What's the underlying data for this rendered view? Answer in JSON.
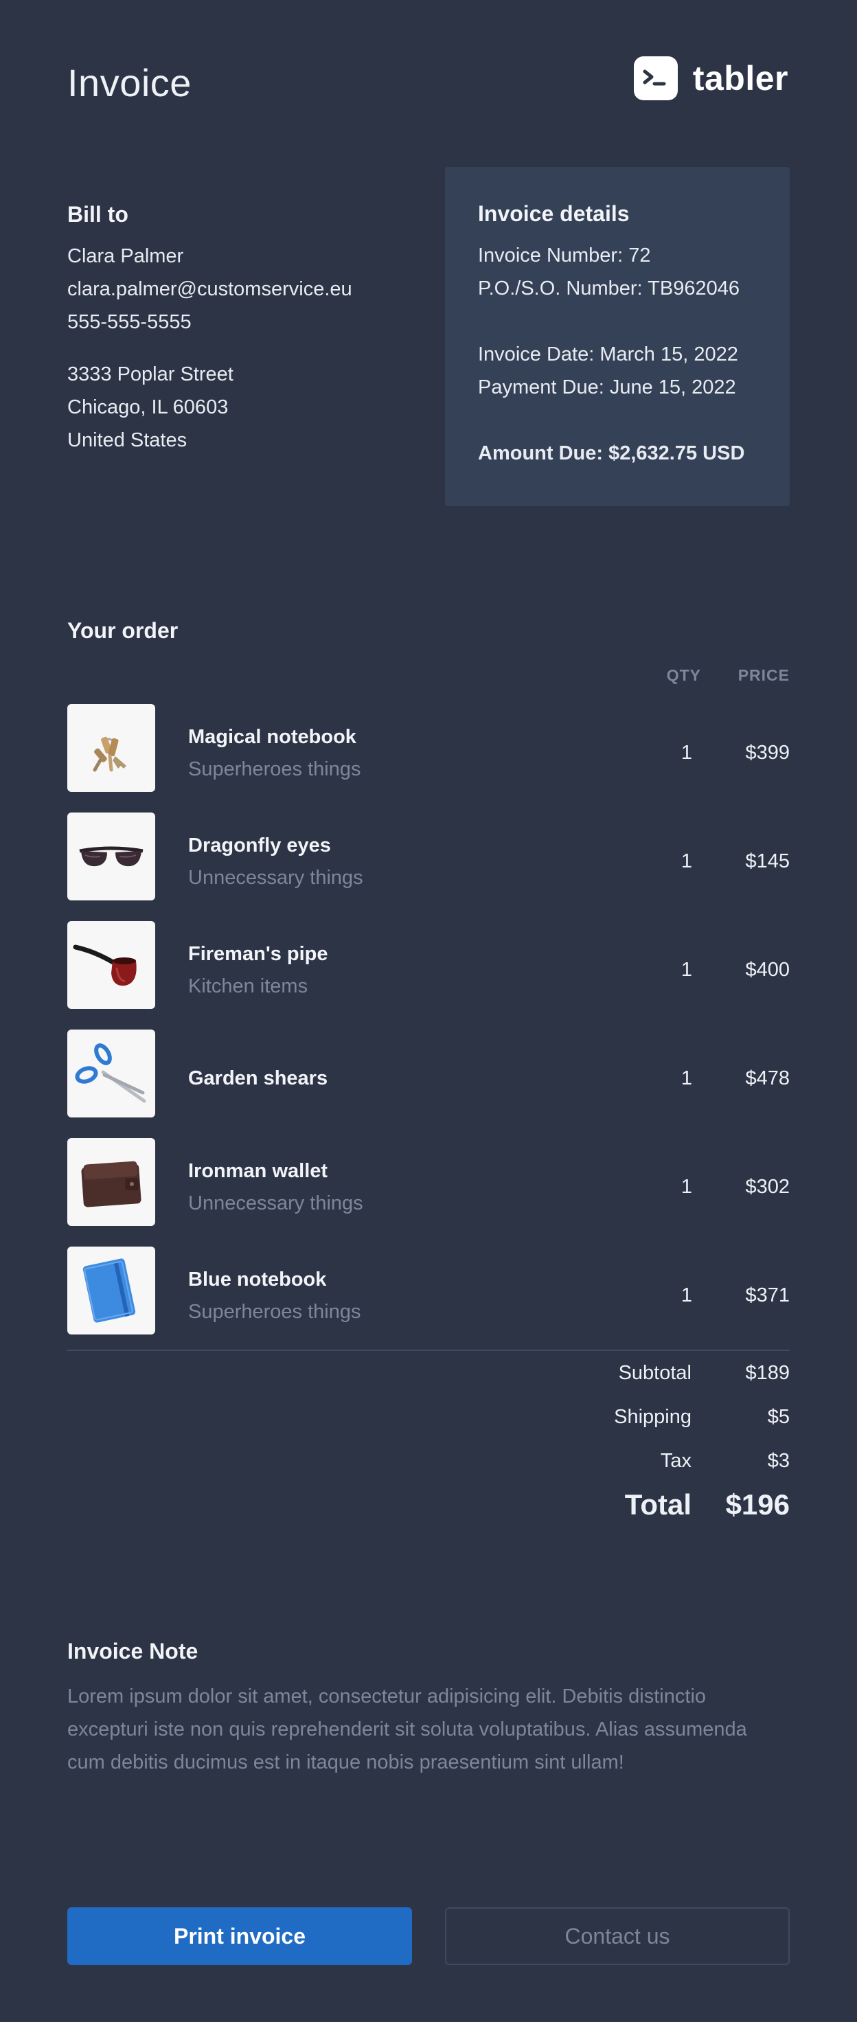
{
  "header": {
    "title": "Invoice",
    "brand_name": "tabler",
    "brand_icon": "terminal-icon"
  },
  "bill_to": {
    "heading": "Bill to",
    "name": "Clara Palmer",
    "email": "clara.palmer@customservice.eu",
    "phone": "555-555-5555",
    "street": "3333 Poplar Street",
    "city": "Chicago, IL 60603",
    "country": "United States"
  },
  "invoice_details": {
    "heading": "Invoice details",
    "invoice_number": "Invoice Number: 72",
    "po_number": "P.O./S.O. Number: TB962046",
    "invoice_date": "Invoice Date: March 15, 2022",
    "payment_due": "Payment Due: June 15, 2022",
    "amount_due": "Amount Due: $2,632.75 USD"
  },
  "order": {
    "heading": "Your order",
    "col_qty": "QTY",
    "col_price": "PRICE",
    "items": [
      {
        "name": "Magical notebook",
        "category": "Superheroes things",
        "qty": "1",
        "price": "$399",
        "image": "keys-image"
      },
      {
        "name": "Dragonfly eyes",
        "category": "Unnecessary things",
        "qty": "1",
        "price": "$145",
        "image": "sunglasses-image"
      },
      {
        "name": "Fireman's pipe",
        "category": "Kitchen items",
        "qty": "1",
        "price": "$400",
        "image": "pipe-image"
      },
      {
        "name": "Garden shears",
        "category": "",
        "qty": "1",
        "price": "$478",
        "image": "scissors-image"
      },
      {
        "name": "Ironman wallet",
        "category": "Unnecessary things",
        "qty": "1",
        "price": "$302",
        "image": "wallet-image"
      },
      {
        "name": "Blue notebook",
        "category": "Superheroes things",
        "qty": "1",
        "price": "$371",
        "image": "notebook-image"
      }
    ]
  },
  "totals": {
    "subtotal_label": "Subtotal",
    "subtotal_value": "$189",
    "shipping_label": "Shipping",
    "shipping_value": "$5",
    "tax_label": "Tax",
    "tax_value": "$3",
    "total_label": "Total",
    "total_value": "$196"
  },
  "note": {
    "heading": "Invoice Note",
    "text": "Lorem ipsum dolor sit amet, consectetur adipisicing elit. Debitis distinctio excepturi iste non quis reprehenderit sit soluta voluptatibus. Alias assumenda cum debitis ducimus est in itaque nobis praesentium sint ullam!"
  },
  "actions": {
    "print_label": "Print invoice",
    "contact_label": "Contact us"
  },
  "colors": {
    "background": "#2c3446",
    "panel": "#354157",
    "primary": "#206bc4",
    "muted_text": "#7d8799"
  }
}
